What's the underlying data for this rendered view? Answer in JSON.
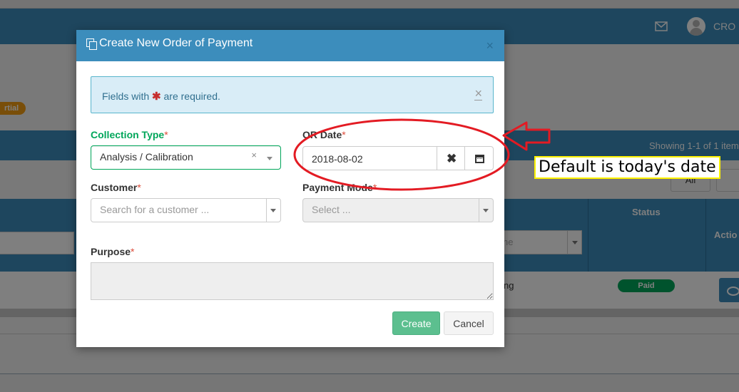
{
  "background": {
    "user_name": "CRO",
    "badge": "rtial",
    "showing": "Showing 1-1 of 1 item",
    "all_button": "All",
    "columns": {
      "e": "e",
      "status": "Status",
      "action": "Actio"
    },
    "filter_placeholder": "ne",
    "row_text": "ng",
    "status_value": "Paid"
  },
  "modal": {
    "title": "Create New Order of Payment",
    "close": "×",
    "alert": {
      "before": "Fields with",
      "after": "are required.",
      "star": "✱",
      "close": "×"
    },
    "collection_type": {
      "label": "Collection Type",
      "value": "Analysis / Calibration",
      "clear": "×"
    },
    "or_date": {
      "label": "OR Date",
      "value": "2018-08-02"
    },
    "customer": {
      "label": "Customer",
      "placeholder": "Search for a customer ..."
    },
    "payment_mode": {
      "label": "Payment Mode",
      "placeholder": "Select ..."
    },
    "purpose": {
      "label": "Purpose"
    },
    "required_mark": "*",
    "buttons": {
      "create": "Create",
      "cancel": "Cancel"
    }
  },
  "annotation": {
    "note": "Default is today's date",
    "ellipse_color": "#e31b23",
    "arrow_color": "#e31b23",
    "note_border_color": "#fff200"
  }
}
